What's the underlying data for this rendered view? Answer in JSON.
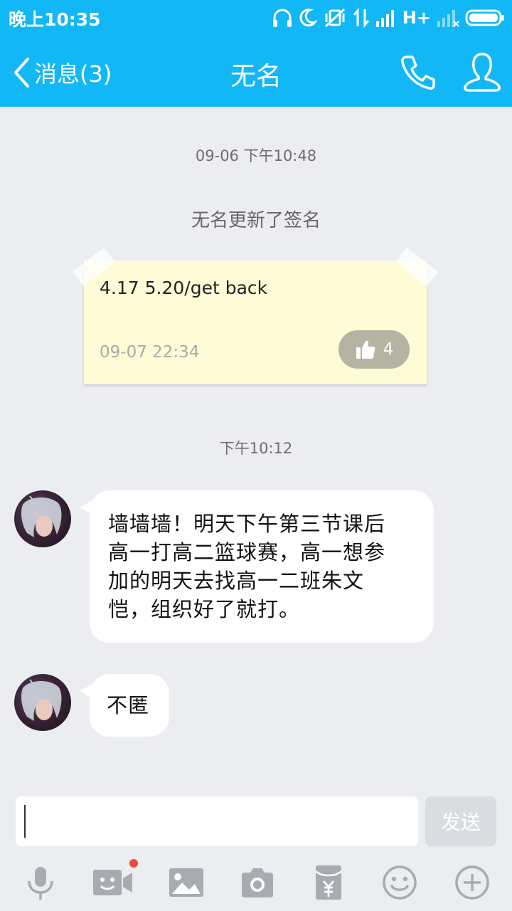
{
  "status_bar": {
    "time": "晚上10:35",
    "network": "H+"
  },
  "header": {
    "back_label": "消息(3)",
    "title": "无名"
  },
  "chat": {
    "timestamp_1": "09-06 下午10:48",
    "system_message": "无名更新了签名",
    "signature_card": {
      "text": "4.17 5.20/get back",
      "date": "09-07 22:34",
      "likes": "4"
    },
    "timestamp_2": "下午10:12",
    "messages": [
      {
        "lines": [
          "墙墙墙！明天下午第三节课后",
          "高一打高二篮球赛，高一想参",
          "加的明天去找高一二班朱文",
          "恺，组织好了就打。"
        ]
      },
      {
        "lines": [
          "不匿"
        ]
      }
    ]
  },
  "input": {
    "value": "",
    "send_label": "发送"
  },
  "toolbar": {
    "icons": [
      "microphone-icon",
      "video-call-icon",
      "image-icon",
      "camera-icon",
      "red-packet-icon",
      "emoji-icon",
      "plus-icon"
    ]
  },
  "colors": {
    "accent": "#12b7f5",
    "background": "#ebedf1",
    "note": "#fffbd6",
    "badge": "#f04b36"
  }
}
